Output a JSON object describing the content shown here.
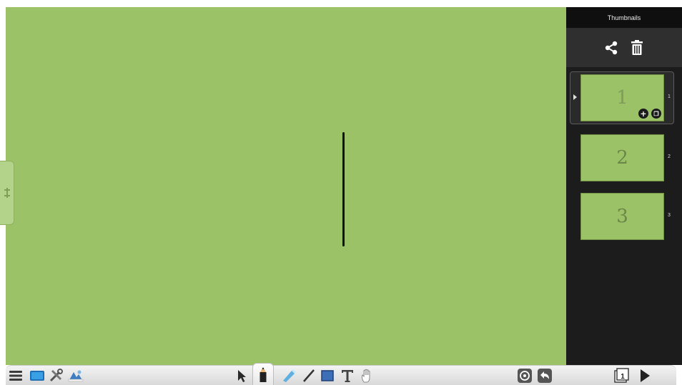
{
  "panel": {
    "title": "Thumbnails",
    "actions": [
      {
        "icon": "share-icon"
      },
      {
        "icon": "trash-icon"
      }
    ],
    "thumbnails": [
      {
        "page_text": "1",
        "number": "1",
        "selected": true
      },
      {
        "page_text": "2",
        "number": "2",
        "selected": false
      },
      {
        "page_text": "3",
        "number": "3",
        "selected": false
      }
    ]
  },
  "canvas": {
    "background_color": "#9bc267"
  },
  "toolbar": {
    "left_tools": [
      "menu-icon",
      "display-icon",
      "tools-icon",
      "gallery-icon"
    ],
    "center_tools": [
      "select-arrow-icon",
      "pen-icon",
      "highlighter-icon",
      "line-icon",
      "rectangle-icon",
      "text-icon",
      "hand-icon"
    ],
    "active_tool": "pen-icon",
    "right_tools": [
      "target-icon",
      "undo-icon"
    ],
    "page": {
      "current": "1"
    },
    "nav": [
      "next-page-icon"
    ]
  }
}
